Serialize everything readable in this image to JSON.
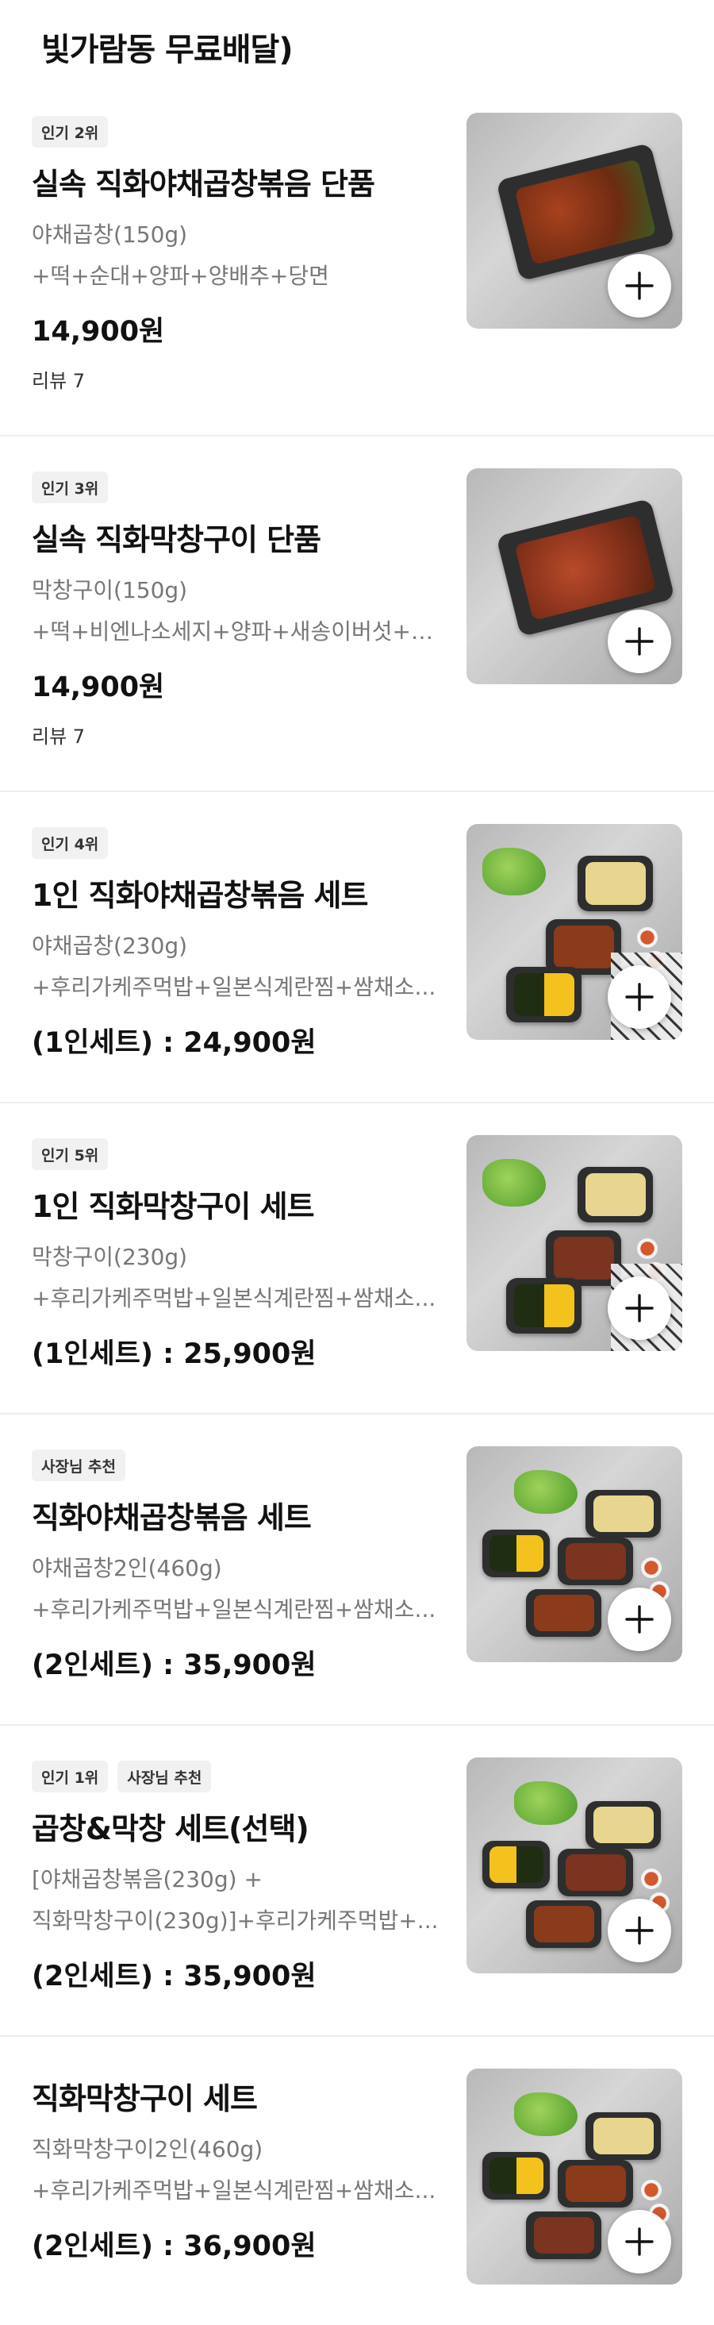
{
  "header": {
    "title": "빛가람동 무료배달)"
  },
  "items": [
    {
      "badges": [
        "인기 2위"
      ],
      "name": "실속 직화야채곱창볶음 단품",
      "desc1": "야채곱창(150g)",
      "desc2": "+떡+순대+양파+양배추+당면",
      "price": "14,900원",
      "review": "리뷰 7",
      "image": "single"
    },
    {
      "badges": [
        "인기 3위"
      ],
      "name": "실속 직화막창구이 단품",
      "desc1": "막창구이(150g)",
      "desc2": "+떡+비엔나소세지+양파+새송이버섯+소...",
      "price": "14,900원",
      "review": "리뷰 7",
      "image": "single"
    },
    {
      "badges": [
        "인기 4위"
      ],
      "name": "1인 직화야채곱창볶음 세트",
      "desc1": "야채곱창(230g)",
      "desc2": "+후리가케주먹밥+일본식계란찜+쌈채소...",
      "price": "(1인세트) : 24,900원",
      "image": "set"
    },
    {
      "badges": [
        "인기 5위"
      ],
      "name": "1인 직화막창구이 세트",
      "desc1": "막창구이(230g)",
      "desc2": "+후리가케주먹밥+일본식계란찜+쌈채소...",
      "price": "(1인세트) : 25,900원",
      "image": "set"
    },
    {
      "badges": [
        "사장님 추천"
      ],
      "name": "직화야채곱창볶음 세트",
      "desc1": "야채곱창2인(460g)",
      "desc2": "+후리가케주먹밥+일본식계란찜+쌈채소...",
      "price": "(2인세트) : 35,900원",
      "image": "set"
    },
    {
      "badges": [
        "인기 1위",
        "사장님 추천"
      ],
      "name": "곱창&막창 세트(선택)",
      "desc1": "[야채곱창볶음(230g) +",
      "desc2": "직화막창구이(230g)]+후리가케주먹밥+...",
      "price": "(2인세트) : 35,900원",
      "image": "set"
    },
    {
      "badges": [],
      "name": "직화막창구이 세트",
      "desc1": "직화막창구이2인(460g)",
      "desc2": "+후리가케주먹밥+일본식계란찜+쌈채소...",
      "price": "(2인세트) : 36,900원",
      "image": "set"
    }
  ],
  "icons": {
    "add": "plus-icon"
  },
  "colors": {
    "badge_bg": "#f1f1f1",
    "desc": "#777777",
    "divider": "#eeeeee"
  }
}
